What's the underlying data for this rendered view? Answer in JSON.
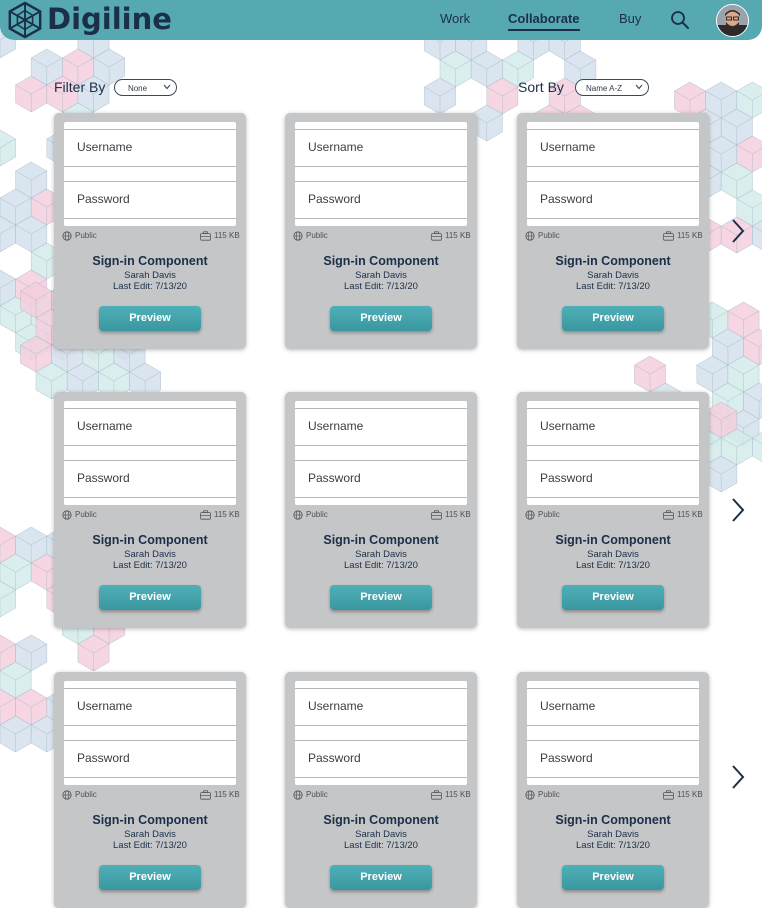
{
  "header": {
    "brand": "Digiline",
    "nav": [
      {
        "label": "Work",
        "active": false
      },
      {
        "label": "Collaborate",
        "active": true
      },
      {
        "label": "Buy",
        "active": false
      }
    ]
  },
  "filter": {
    "label": "Filter By",
    "value": "None"
  },
  "sort": {
    "label": "Sort By",
    "value": "Name A-Z"
  },
  "cards": [
    {
      "username_placeholder": "Username",
      "password_placeholder": "Password",
      "visibility": "Public",
      "size": "115 KB",
      "title": "Sign-in Component",
      "author": "Sarah Davis",
      "last_edit": "Last Edit: 7/13/20",
      "button": "Preview"
    },
    {
      "username_placeholder": "Username",
      "password_placeholder": "Password",
      "visibility": "Public",
      "size": "115 KB",
      "title": "Sign-in Component",
      "author": "Sarah Davis",
      "last_edit": "Last Edit: 7/13/20",
      "button": "Preview"
    },
    {
      "username_placeholder": "Username",
      "password_placeholder": "Password",
      "visibility": "Public",
      "size": "115 KB",
      "title": "Sign-in Component",
      "author": "Sarah Davis",
      "last_edit": "Last Edit: 7/13/20",
      "button": "Preview"
    },
    {
      "username_placeholder": "Username",
      "password_placeholder": "Password",
      "visibility": "Public",
      "size": "115 KB",
      "title": "Sign-in Component",
      "author": "Sarah Davis",
      "last_edit": "Last Edit: 7/13/20",
      "button": "Preview"
    },
    {
      "username_placeholder": "Username",
      "password_placeholder": "Password",
      "visibility": "Public",
      "size": "115 KB",
      "title": "Sign-in Component",
      "author": "Sarah Davis",
      "last_edit": "Last Edit: 7/13/20",
      "button": "Preview"
    },
    {
      "username_placeholder": "Username",
      "password_placeholder": "Password",
      "visibility": "Public",
      "size": "115 KB",
      "title": "Sign-in Component",
      "author": "Sarah Davis",
      "last_edit": "Last Edit: 7/13/20",
      "button": "Preview"
    },
    {
      "username_placeholder": "Username",
      "password_placeholder": "Password",
      "visibility": "Public",
      "size": "115 KB",
      "title": "Sign-in Component",
      "author": "Sarah Davis",
      "last_edit": "Last Edit: 7/13/20",
      "button": "Preview"
    },
    {
      "username_placeholder": "Username",
      "password_placeholder": "Password",
      "visibility": "Public",
      "size": "115 KB",
      "title": "Sign-in Component",
      "author": "Sarah Davis",
      "last_edit": "Last Edit: 7/13/20",
      "button": "Preview"
    },
    {
      "username_placeholder": "Username",
      "password_placeholder": "Password",
      "visibility": "Public",
      "size": "115 KB",
      "title": "Sign-in Component",
      "author": "Sarah Davis",
      "last_edit": "Last Edit: 7/13/20",
      "button": "Preview"
    }
  ],
  "icons": {
    "logo": "cube-logo-icon",
    "search": "search-icon",
    "avatar": "user-avatar",
    "dropdown": "chevron-down-icon",
    "visibility": "globe-icon",
    "size": "briefcase-icon",
    "next": "chevron-right-icon"
  },
  "colors": {
    "header": "#56a9b1",
    "text_dark": "#1b2f48",
    "card": "#c5c6c8",
    "button": "#3a97a0",
    "hex_pink": "#f3cfdd",
    "hex_blue": "#d4e0ec",
    "hex_mint": "#d3ecea"
  }
}
